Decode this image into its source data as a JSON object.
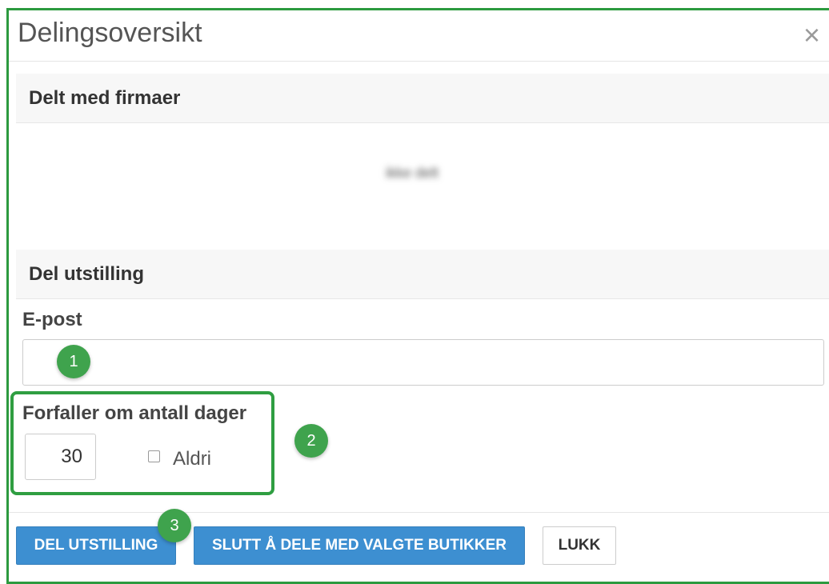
{
  "modal": {
    "title": "Delingsoversikt",
    "close_glyph": "×"
  },
  "shared_section": {
    "heading": "Delt med firmaer",
    "blurred_text": "ikke delt"
  },
  "share_section": {
    "heading": "Del utstilling",
    "email_label": "E-post",
    "email_value": "",
    "expires_label": "Forfaller om antall dager",
    "days_value": "30",
    "never_label": "Aldri",
    "never_checked": false
  },
  "annotations": {
    "badge1": "1",
    "badge2": "2",
    "badge3": "3",
    "color": "#3fa34d"
  },
  "footer": {
    "share_button": "DEL UTSTILLING",
    "stop_button": "SLUTT Å DELE MED VALGTE BUTIKKER",
    "close_button": "LUKK"
  },
  "colors": {
    "primary": "#3d8fd1",
    "frame": "#2c9a3f"
  }
}
